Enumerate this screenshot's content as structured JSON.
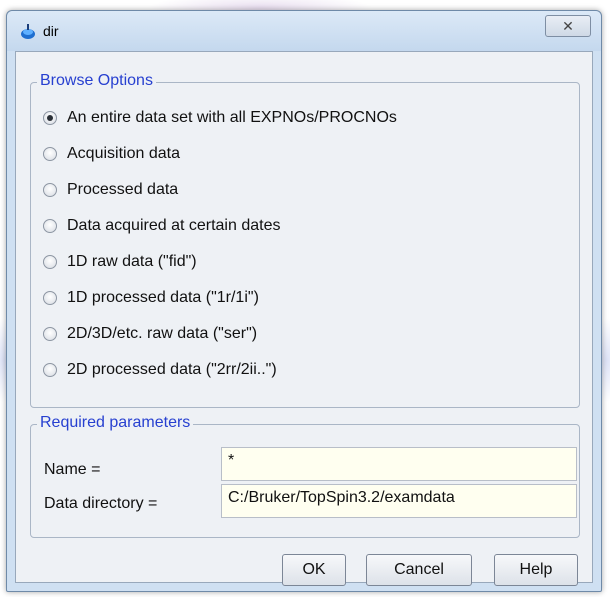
{
  "window": {
    "title": "dir",
    "close_glyph": "✕"
  },
  "browse_options": {
    "title": "Browse Options",
    "options": [
      {
        "label": "An entire data set with all EXPNOs/PROCNOs",
        "checked": true
      },
      {
        "label": "Acquisition data",
        "checked": false
      },
      {
        "label": "Processed data",
        "checked": false
      },
      {
        "label": "Data acquired at certain dates",
        "checked": false
      },
      {
        "label": "1D raw data (\"fid\")",
        "checked": false
      },
      {
        "label": "1D processed data (\"1r/1i\")",
        "checked": false
      },
      {
        "label": "2D/3D/etc. raw data (\"ser\")",
        "checked": false
      },
      {
        "label": "2D processed data (\"2rr/2ii..\")",
        "checked": false
      }
    ]
  },
  "required_parameters": {
    "title": "Required parameters",
    "name_label": "Name =",
    "name_value": "*",
    "directory_label": "Data directory =",
    "directory_value": "C:/Bruker/TopSpin3.2/examdata"
  },
  "buttons": {
    "ok": "OK",
    "cancel": "Cancel",
    "help": "Help"
  },
  "icons": {
    "app": "topspin-app-icon",
    "close": "close-icon"
  }
}
